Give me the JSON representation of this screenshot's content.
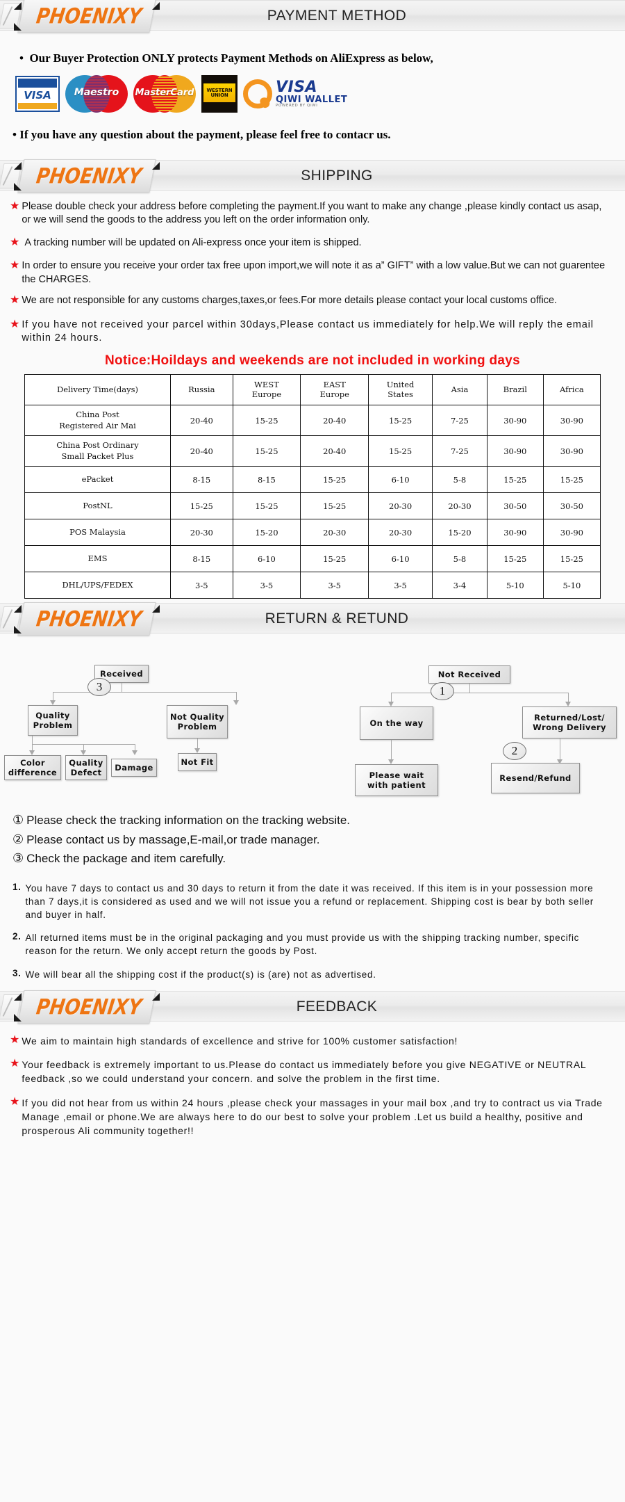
{
  "brand": "PHOENIXY",
  "sections": [
    {
      "id": "payment",
      "title": "PAYMENT METHOD"
    },
    {
      "id": "shipping",
      "title": "SHIPPING"
    },
    {
      "id": "return",
      "title": "RETURN & RETUND"
    },
    {
      "id": "feedback",
      "title": "FEEDBACK"
    }
  ],
  "payment": {
    "intro": "Our Buyer Protection ONLY protects Payment Methods on AliExpress as below,",
    "outro": "If you have any question about the payment, please feel free to contacr us.",
    "bullet": "•",
    "logos": [
      {
        "name": "visa-logo",
        "label": "VISA"
      },
      {
        "name": "maestro-logo",
        "label": "Maestro"
      },
      {
        "name": "mastercard-logo",
        "label": "MasterCard"
      },
      {
        "name": "western-union-logo",
        "line1": "WESTERN",
        "line2": "UNION"
      },
      {
        "name": "qiwi-wallet-logo",
        "visa": "VISA",
        "wallet": "QIWI WALLET",
        "powered": "POWERED BY QIWI"
      }
    ]
  },
  "shipping": {
    "bullets": [
      "Please double check your address before completing the payment.If you want to make any change ,please kindly contact us asap, or we will send the goods to the address you left on the order information only.",
      "A tracking number will be updated on Ali-express once your item is shipped.",
      "In order to ensure you receive your order tax free upon import,we will note it as a” GIFT” with a low value.But we can not guarentee the CHARGES.",
      "We are not responsible for any customs charges,taxes,or fees.For more details please contact your local customs office.",
      "If you have not received your parcel within 30days,Please contact us immediately for help.We will reply the email within 24 hours."
    ],
    "notice": "Notice:Hoildays and weekends are not included in working days",
    "star": "★"
  },
  "delivery_table": {
    "headers": [
      "Delivery Time(days)",
      "Russia",
      "WEST\nEurope",
      "EAST\nEurope",
      "United\nStates",
      "Asia",
      "Brazil",
      "Africa"
    ],
    "rows": [
      {
        "method": "China Post\nRegistered Air Mai",
        "values": [
          "20-40",
          "15-25",
          "20-40",
          "15-25",
          "7-25",
          "30-90",
          "30-90"
        ]
      },
      {
        "method": "China Post Ordinary\nSmall Packet Plus",
        "values": [
          "20-40",
          "15-25",
          "20-40",
          "15-25",
          "7-25",
          "30-90",
          "30-90"
        ]
      },
      {
        "method": "ePacket",
        "values": [
          "8-15",
          "8-15",
          "15-25",
          "6-10",
          "5-8",
          "15-25",
          "15-25"
        ]
      },
      {
        "method": "PostNL",
        "values": [
          "15-25",
          "15-25",
          "15-25",
          "20-30",
          "20-30",
          "30-50",
          "30-50"
        ]
      },
      {
        "method": "POS Malaysia",
        "values": [
          "20-30",
          "15-20",
          "20-30",
          "20-30",
          "15-20",
          "30-90",
          "30-90"
        ]
      },
      {
        "method": "EMS",
        "values": [
          "8-15",
          "6-10",
          "15-25",
          "6-10",
          "5-8",
          "15-25",
          "15-25"
        ]
      },
      {
        "method": "DHL/UPS/FEDEX",
        "values": [
          "3-5",
          "3-5",
          "3-5",
          "3-5",
          "3-4",
          "5-10",
          "5-10"
        ]
      }
    ]
  },
  "flowchart": {
    "left": {
      "root": "Received",
      "marker": "3",
      "branch_a": "Quality\nProblem",
      "branch_b": "Not Quality\nProblem",
      "leaves_a": [
        "Color\ndifference",
        "Quality\nDefect",
        "Damage"
      ],
      "leaf_b": "Not Fit"
    },
    "right": {
      "root": "Not  Received",
      "marker_1": "1",
      "marker_2": "2",
      "branch_a": "On the way",
      "branch_b": "Returned/Lost/\nWrong Delivery",
      "leaf_a": "Please wait\nwith patient",
      "leaf_b": "Resend/Refund"
    }
  },
  "return_notes": [
    {
      "num": "①",
      "text": "Please check the tracking information on the tracking website."
    },
    {
      "num": "②",
      "text": "Please contact us by  massage,E-mail,or trade manager."
    },
    {
      "num": "③",
      "text": "Check the package and item carefully."
    }
  ],
  "return_policy": [
    {
      "n": "1.",
      "t": "You have 7 days to contact us and 30 days to return it from the date it was received. If this item is in your possession more than 7 days,it is considered as used and we will not issue you a refund or replacement. Shipping cost is bear by both seller and buyer in half."
    },
    {
      "n": "2.",
      "t": "All returned items must be in the original packaging and you must provide us with the shipping tracking number, specific reason for the return. We only accept return the goods by Post."
    },
    {
      "n": "3.",
      "t": "We will bear all the shipping cost if the product(s) is (are) not as advertised."
    }
  ],
  "feedback": [
    "We aim to maintain high standards of excellence and strive  for 100% customer satisfaction!",
    "Your feedback is extremely important to us.Please do contact us immediately before you give NEGATIVE or NEUTRAL feedback ,so  we could understand your concern. and solve the problem in the first time.",
    "If you did not hear from us within 24 hours ,please check your massages in your mail box ,and try to contract us via Trade Manage ,email or phone.We are always here to do our best to solve your problem .Let us build a healthy, positive and prosperous Ali community together!!"
  ],
  "colors": {
    "brand_orange": "#ee7513",
    "star_red": "#e8131b",
    "notice_red": "#f01010"
  }
}
